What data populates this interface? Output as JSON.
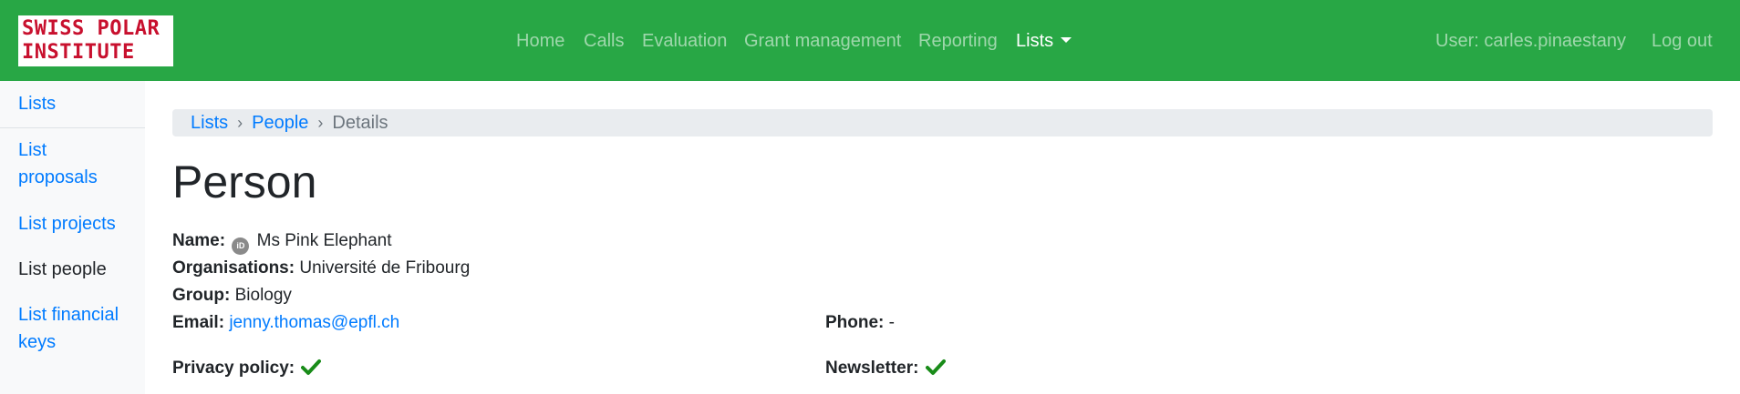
{
  "brand": {
    "line1": "SWISS POLAR",
    "line2": "INSTITUTE",
    "color": "#c8102e"
  },
  "colors": {
    "navbar": "#28a745",
    "link": "#007bff",
    "success": "#198c19"
  },
  "nav": {
    "home": "Home",
    "calls": "Calls",
    "evaluation": "Evaluation",
    "grant_management": "Grant management",
    "reporting": "Reporting",
    "lists": "Lists",
    "user": "User: carles.pinaestany",
    "logout": "Log out"
  },
  "sidebar": {
    "items": [
      {
        "label": "Lists"
      },
      {
        "label": "List proposals"
      },
      {
        "label": "List projects"
      },
      {
        "label": "List people"
      },
      {
        "label": "List financial keys"
      }
    ]
  },
  "breadcrumb": {
    "lists": "Lists",
    "people": "People",
    "current": "Details"
  },
  "page": {
    "title": "Person"
  },
  "person": {
    "name_label": "Name:",
    "orcid_icon": "orcid-icon",
    "orcid_text": "iD",
    "name": "Ms Pink Elephant",
    "organisations_label": "Organisations:",
    "organisations": "Université de Fribourg",
    "group_label": "Group:",
    "group": "Biology",
    "email_label": "Email:",
    "email": "jenny.thomas@epfl.ch",
    "phone_label": "Phone:",
    "phone": "-",
    "privacy_label": "Privacy policy:",
    "privacy_accepted": true,
    "newsletter_label": "Newsletter:",
    "newsletter_subscribed": true
  }
}
